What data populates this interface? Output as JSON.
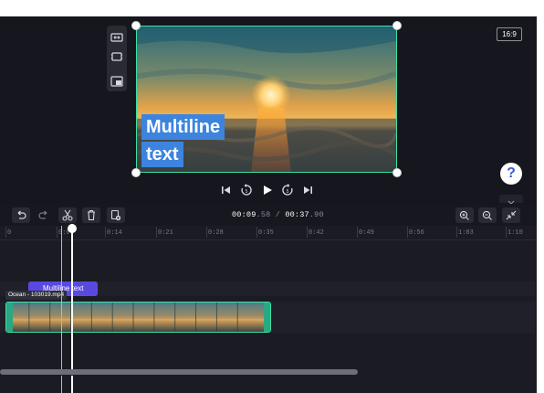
{
  "preview": {
    "aspect_ratio_label": "16:9",
    "caption_line1": "Multiline",
    "caption_line2": "text",
    "help_label": "?"
  },
  "icons": {
    "side_tools": [
      "fit-icon",
      "crop-icon",
      "picture-in-picture-icon"
    ],
    "playback": [
      "skip-back-icon",
      "rewind-5-icon",
      "play-icon",
      "forward-5-icon",
      "skip-forward-icon"
    ],
    "toolbar_left": [
      "undo-icon",
      "redo-icon",
      "split-icon",
      "delete-icon",
      "duplicate-icon"
    ],
    "toolbar_right": [
      "zoom-in-icon",
      "zoom-out-icon",
      "fit-timeline-icon"
    ]
  },
  "timecode": {
    "current_main": "00:09",
    "current_frac": ".58",
    "separator": " / ",
    "total_main": "00:37",
    "total_frac": ".90"
  },
  "ruler": {
    "ticks": [
      "0",
      "0:07",
      "0:14",
      "0:21",
      "0:28",
      "0:35",
      "0:42",
      "0:49",
      "0:56",
      "1:03",
      "1:10"
    ]
  },
  "timeline": {
    "text_clip_label": "Multiline text",
    "video_clip_label": "Ocean - 103019.mp4"
  },
  "colors": {
    "accent_green": "#3de0a6",
    "caption_blue": "#3c84de",
    "text_clip_purple": "#5a49e0"
  }
}
